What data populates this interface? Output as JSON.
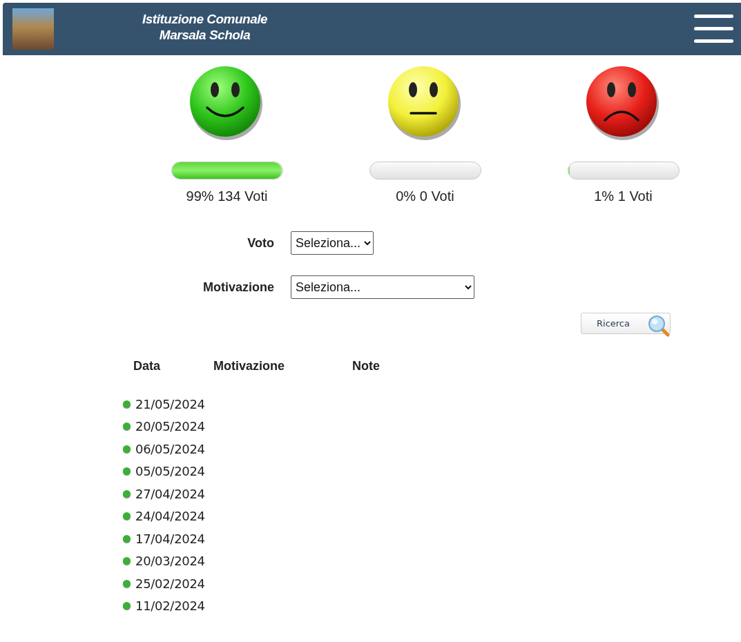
{
  "header": {
    "title_lines": [
      "Istituzione Comunale",
      "Marsala Schola"
    ]
  },
  "votes": [
    {
      "kind": "happy",
      "level": 0.99,
      "label": "99% 134 Voti"
    },
    {
      "kind": "neutral",
      "level": 0,
      "label": "0% 0 Voti"
    },
    {
      "kind": "sad",
      "level": 0.01,
      "label": "1% 1 Voti"
    }
  ],
  "filters": [
    {
      "label": "Voto",
      "value": "Seleziona..."
    },
    {
      "label": "Motivazione",
      "value": "Seleziona..."
    }
  ],
  "search_button": {
    "label": "Ricerca"
  },
  "table": {
    "columns": [
      "Data",
      "Motivazione",
      "Note"
    ],
    "rows": [
      {
        "date": "21/05/2024"
      },
      {
        "date": "20/05/2024"
      },
      {
        "date": "06/05/2024"
      },
      {
        "date": "05/05/2024"
      },
      {
        "date": "27/04/2024"
      },
      {
        "date": "24/04/2024"
      },
      {
        "date": "17/04/2024"
      },
      {
        "date": "20/03/2024"
      },
      {
        "date": "25/02/2024"
      },
      {
        "date": "11/02/2024"
      }
    ]
  }
}
